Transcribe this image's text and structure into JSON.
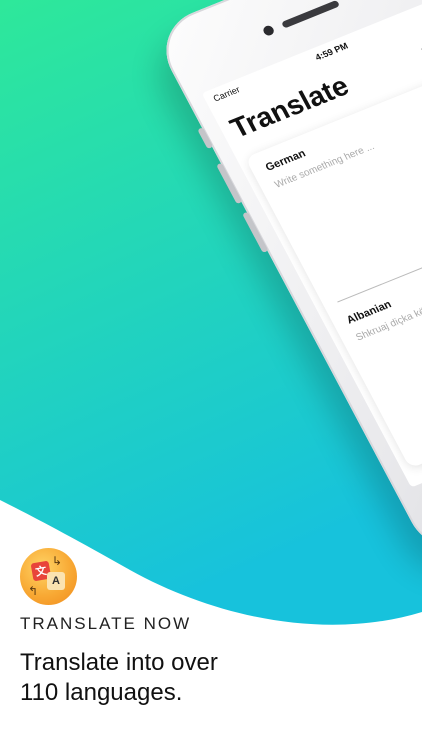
{
  "colors": {
    "gradient_top": "#2ee89a",
    "gradient_bottom": "#17c2dc",
    "app_icon_orange": "#f8a934",
    "app_icon_red": "#e8443a"
  },
  "phone": {
    "status": {
      "carrier": "Carrier",
      "time": "4:59 PM"
    },
    "title": "Translate",
    "icons": [
      "speaker-icon",
      "copy-icon"
    ],
    "source": {
      "language": "German",
      "placeholder": "Write something here ..."
    },
    "swap_icon": "swap-arrows-icon",
    "target": {
      "language": "Albanian",
      "placeholder": "Shkruaj diçka këtu ..."
    }
  },
  "promo": {
    "label": "TRANSLATE NOW",
    "headline_line1": "Translate into over",
    "headline_line2": "110 languages."
  }
}
